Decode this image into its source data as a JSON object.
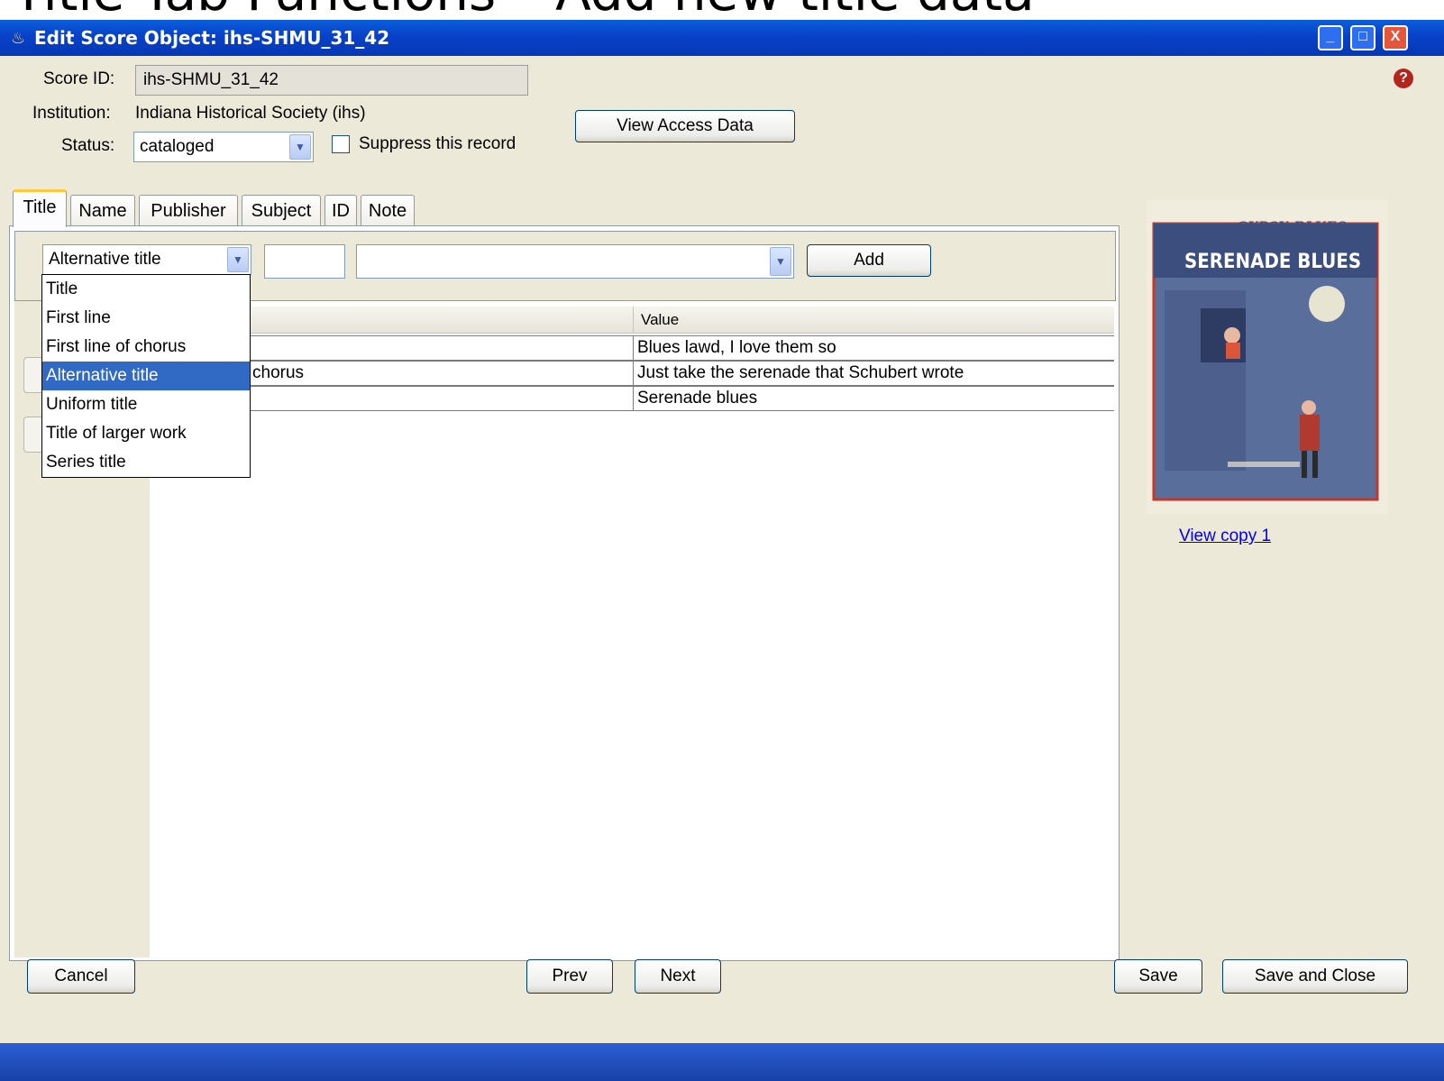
{
  "slide": {
    "title": "Title Tab Functions – Add new title data"
  },
  "window": {
    "title": "Edit Score Object: ihs-SHMU_31_42",
    "controls": {
      "minimize": "_",
      "maximize": "□",
      "close": "X"
    }
  },
  "header": {
    "score_id_label": "Score ID:",
    "score_id_value": "ihs-SHMU_31_42",
    "institution_label": "Institution:",
    "institution_value": "Indiana Historical Society (ihs)",
    "status_label": "Status:",
    "status_value": "cataloged",
    "suppress_label": "Suppress this record",
    "suppress_checked": false,
    "view_access_button": "View Access Data",
    "help_icon": "?"
  },
  "tabs": [
    {
      "label": "Title",
      "active": true
    },
    {
      "label": "Name",
      "active": false
    },
    {
      "label": "Publisher",
      "active": false
    },
    {
      "label": "Subject",
      "active": false
    },
    {
      "label": "ID",
      "active": false
    },
    {
      "label": "Note",
      "active": false
    }
  ],
  "add_form": {
    "type_value": "Alternative title",
    "number_value": "",
    "text_value": "",
    "add_button": "Add"
  },
  "type_dropdown": {
    "options": [
      "Title",
      "First line",
      "First line of chorus",
      "Alternative title",
      "Uniform title",
      "Title of larger work",
      "Series title"
    ],
    "selected": "Alternative title"
  },
  "table": {
    "columns": [
      "",
      "Value"
    ],
    "rows": [
      {
        "type": "",
        "value": "Blues lawd, I love them so"
      },
      {
        "type": "chorus",
        "value": "Just take the serenade that Schubert wrote"
      },
      {
        "type": "",
        "value": "Serenade blues"
      }
    ]
  },
  "preview": {
    "top_text": "GYPSY BLUES",
    "title_text": "SERENADE BLUES",
    "link": "View copy 1"
  },
  "footer": {
    "cancel": "Cancel",
    "prev": "Prev",
    "next": "Next",
    "save": "Save",
    "save_close": "Save and Close"
  },
  "colors": {
    "titlebar": "#0a5fdc",
    "window_bg": "#ece9d8",
    "selection": "#316ac5",
    "link": "#0000ee"
  }
}
